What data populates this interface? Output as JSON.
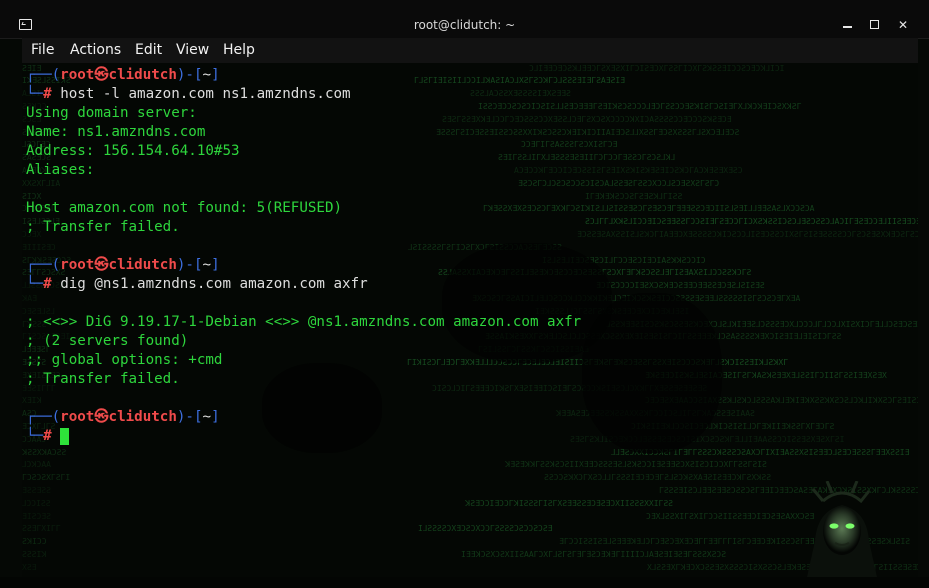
{
  "window": {
    "title": "root@clidutch: ~",
    "icons": {
      "app": "terminal-icon",
      "minimize": "minimize-icon",
      "maximize": "maximize-icon",
      "close": "close-icon"
    },
    "close_glyph": "✕"
  },
  "menu": {
    "items": [
      "File",
      "Actions",
      "Edit",
      "View",
      "Help"
    ]
  },
  "colors": {
    "prompt_frame": "#3d6fe0",
    "prompt_user": "#ef4b4b",
    "output_text": "#2ed63d",
    "command_text": "#dedede",
    "cursor": "#2ee23a"
  },
  "prompt": {
    "frame_open": "┌──(",
    "user": "root",
    "at_symbol": "㉿",
    "host": "clidutch",
    "frame_mid": ")-[",
    "path": "~",
    "frame_close": "]",
    "line2_prefix": "└─",
    "hash": "#"
  },
  "terminal": {
    "blocks": [
      {
        "command": "host -l amazon.com ns1.amzndns.com",
        "output": [
          "Using domain server:",
          "Name: ns1.amzndns.com",
          "Address: 156.154.64.10#53",
          "Aliases:",
          "",
          "Host amazon.com not found: 5(REFUSED)",
          "; Transfer failed."
        ]
      },
      {
        "command": "dig @ns1.amzndns.com amazon.com axfr",
        "output": [
          "",
          "; <<>> DiG 9.19.17-1-Debian <<>> @ns1.amzndns.com amazon.com axfr",
          "; (2 servers found)",
          ";; global options: +cmd",
          "; Transfer failed."
        ]
      },
      {
        "command": "",
        "output": []
      }
    ]
  }
}
